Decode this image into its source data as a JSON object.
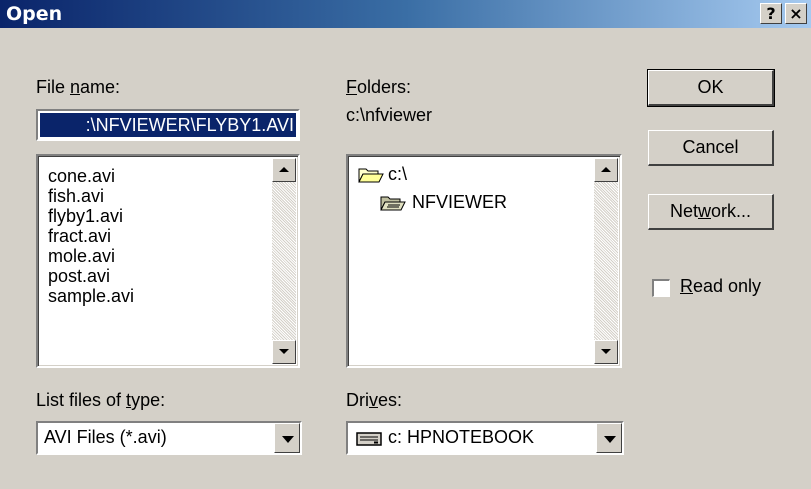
{
  "window": {
    "title": "Open",
    "help_button": "?",
    "close_button": "×"
  },
  "filename": {
    "label_pre": "File ",
    "label_hot": "n",
    "label_post": "ame:",
    "value": ":\\NFVIEWER\\FLYBY1.AVI",
    "files": [
      "cone.avi",
      "fish.avi",
      "flyby1.avi",
      "fract.avi",
      "mole.avi",
      "post.avi",
      "sample.avi"
    ]
  },
  "folders": {
    "label_hot": "F",
    "label_post": "olders:",
    "current_path": "c:\\nfviewer",
    "items": [
      "c:\\",
      "NFVIEWER"
    ]
  },
  "filetype": {
    "label_pre": "List files of ",
    "label_hot": "t",
    "label_post": "ype:",
    "value": "AVI Files (*.avi)"
  },
  "drives": {
    "label_pre": "Dri",
    "label_hot": "v",
    "label_post": "es:",
    "value": "c: HPNOTEBOOK"
  },
  "buttons": {
    "ok": "OK",
    "cancel": "Cancel",
    "network_pre": "Net",
    "network_hot": "w",
    "network_post": "ork..."
  },
  "readonly": {
    "label_hot": "R",
    "label_post": "ead only",
    "checked": false
  },
  "colors": {
    "titlebar_start": "#0a246a",
    "titlebar_end": "#a6caf0",
    "face": "#d4d0c8",
    "selection": "#0a246a"
  }
}
